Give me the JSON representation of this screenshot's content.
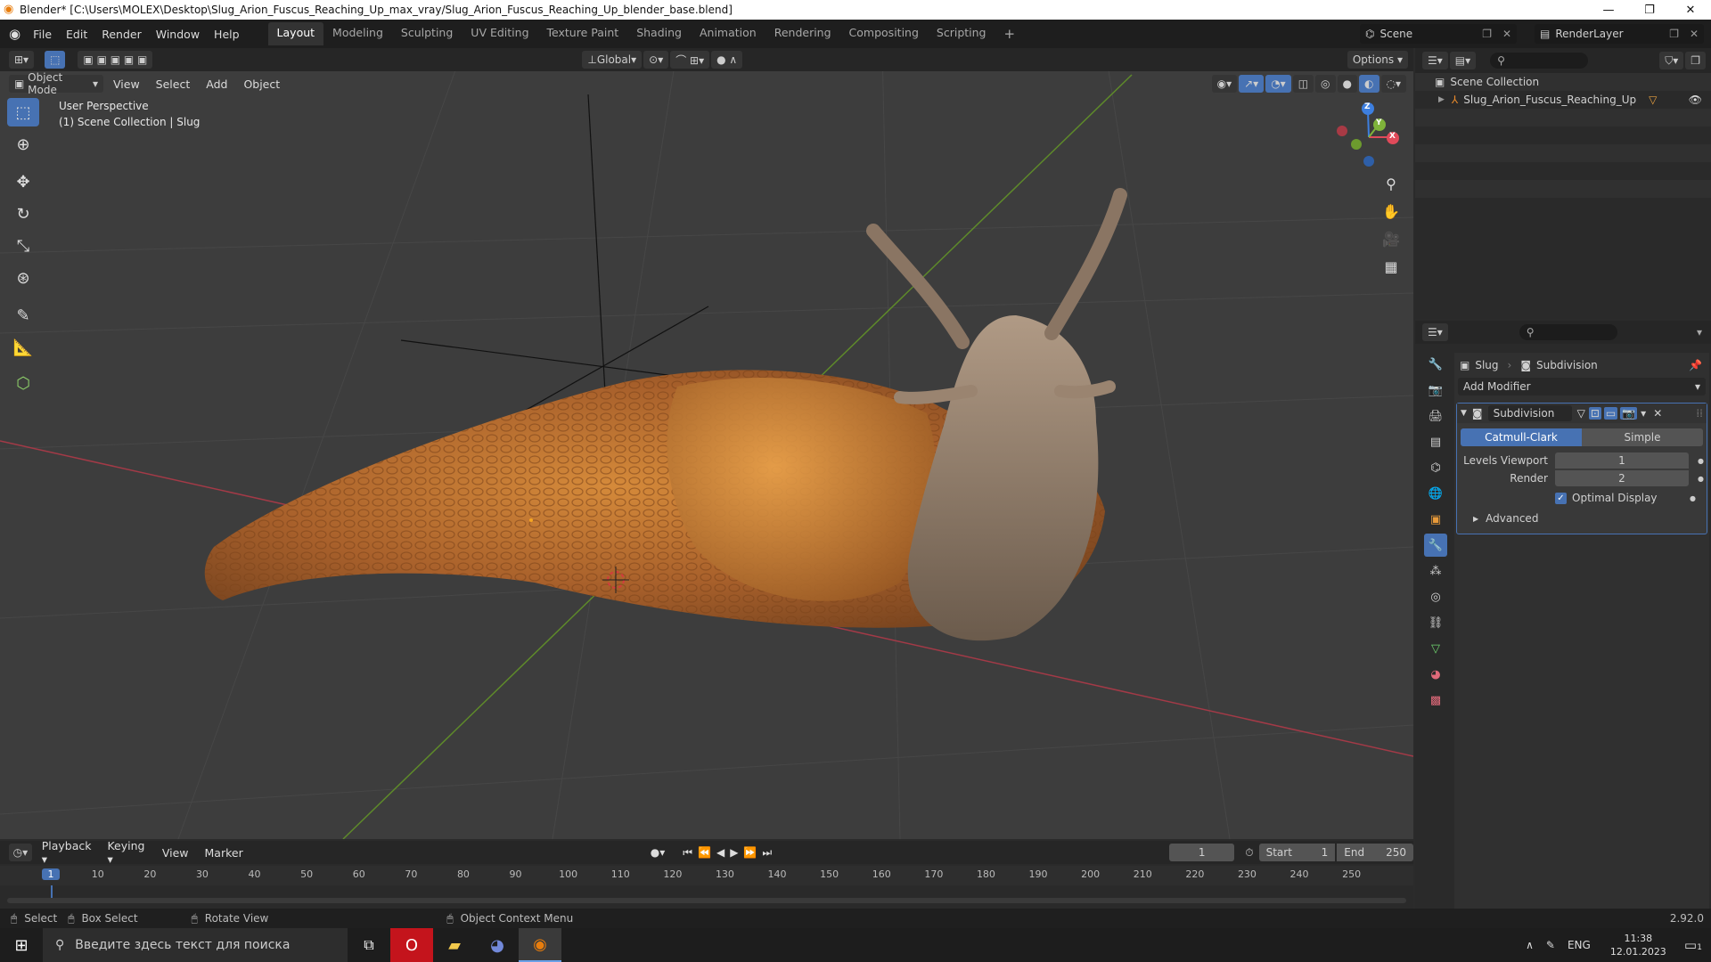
{
  "window": {
    "title": "Blender* [C:\\Users\\MOLEX\\Desktop\\Slug_Arion_Fuscus_Reaching_Up_max_vray/Slug_Arion_Fuscus_Reaching_Up_blender_base.blend]"
  },
  "menubar": {
    "items": [
      "File",
      "Edit",
      "Render",
      "Window",
      "Help"
    ],
    "workspaces": [
      "Layout",
      "Modeling",
      "Sculpting",
      "UV Editing",
      "Texture Paint",
      "Shading",
      "Animation",
      "Rendering",
      "Compositing",
      "Scripting"
    ],
    "active_workspace": "Layout",
    "scene": "Scene",
    "view_layer": "RenderLayer"
  },
  "viewport": {
    "mode": "Object Mode",
    "menus": [
      "View",
      "Select",
      "Add",
      "Object"
    ],
    "orientation": "Global",
    "options_label": "Options",
    "overlay_title": "User Perspective",
    "overlay_sub": "(1) Scene Collection | Slug",
    "gizmo_labels": {
      "x": "X",
      "y": "Y",
      "z": "Z"
    }
  },
  "outliner": {
    "root": "Scene Collection",
    "items": [
      {
        "name": "Slug_Arion_Fuscus_Reaching_Up"
      }
    ]
  },
  "properties": {
    "breadcrumb": [
      "Slug",
      "Subdivision"
    ],
    "add_modifier": "Add Modifier",
    "modifier": {
      "name": "Subdivision",
      "type_options": [
        "Catmull-Clark",
        "Simple"
      ],
      "active_type": "Catmull-Clark",
      "levels_viewport_label": "Levels Viewport",
      "levels_viewport": "1",
      "render_label": "Render",
      "render": "2",
      "optimal_display_label": "Optimal Display",
      "optimal_display": true,
      "advanced_label": "Advanced"
    }
  },
  "timeline": {
    "menus": [
      "Playback",
      "Keying",
      "View",
      "Marker"
    ],
    "current_frame": "1",
    "start_label": "Start",
    "start": "1",
    "end_label": "End",
    "end": "250",
    "ruler": [
      "1",
      "10",
      "20",
      "30",
      "40",
      "50",
      "60",
      "70",
      "80",
      "90",
      "100",
      "110",
      "120",
      "130",
      "140",
      "150",
      "160",
      "170",
      "180",
      "190",
      "200",
      "210",
      "220",
      "230",
      "240",
      "250"
    ]
  },
  "statusbar": {
    "select": "Select",
    "box_select": "Box Select",
    "rotate_view": "Rotate View",
    "context_menu": "Object Context Menu",
    "version": "2.92.0"
  },
  "taskbar": {
    "search_placeholder": "Введите здесь текст для поиска",
    "lang": "ENG",
    "time": "11:38",
    "date": "12.01.2023",
    "notifications": "1"
  },
  "colors": {
    "accent": "#4772b3",
    "x_axis": "#e04a5a",
    "y_axis": "#7fb33a",
    "z_axis": "#3d7fe0"
  }
}
